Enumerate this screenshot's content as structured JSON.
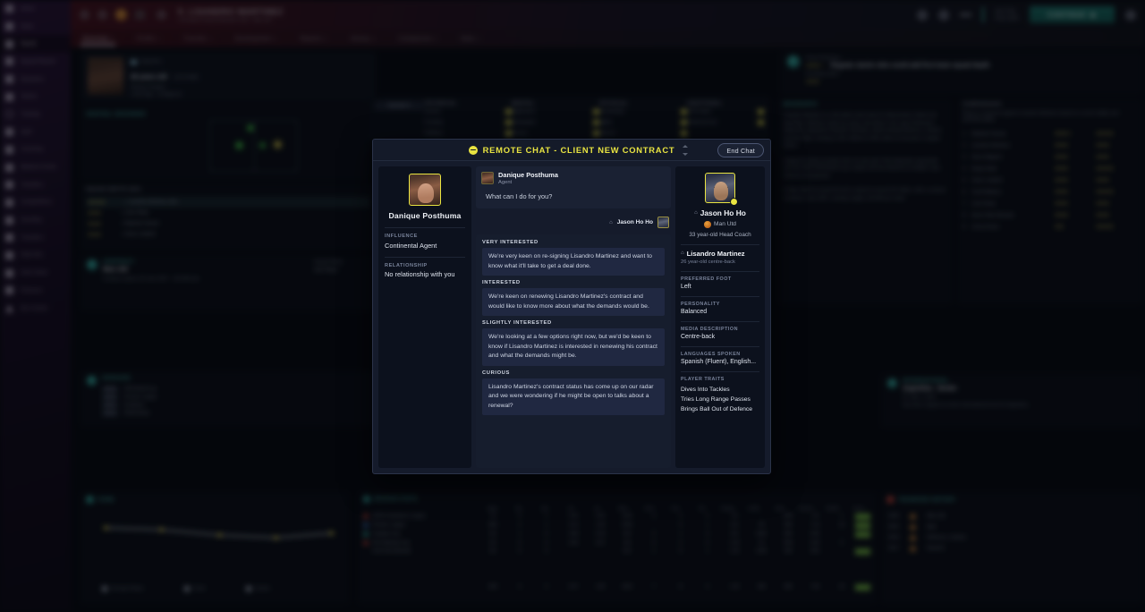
{
  "rail": {
    "items": [
      {
        "label": "Home",
        "icon": "home-icon"
      },
      {
        "label": "Inbox",
        "icon": "inbox-icon"
      },
      {
        "label": "Squad",
        "icon": "squad-icon"
      },
      {
        "label": "Squad Planner",
        "icon": "squad-planner-icon"
      },
      {
        "label": "Dynamics",
        "icon": "dynamics-icon"
      },
      {
        "label": "Tactics",
        "icon": "tactics-icon"
      },
      {
        "label": "Training",
        "icon": "training-icon"
      },
      {
        "label": "Staff",
        "icon": "staff-icon"
      },
      {
        "label": "Coaching",
        "icon": "coaching-icon"
      },
      {
        "label": "Medical Centre",
        "icon": "medical-icon"
      },
      {
        "label": "Transfers",
        "icon": "transfers-icon"
      },
      {
        "label": "Competitions",
        "icon": "competitions-icon"
      },
      {
        "label": "Scouting",
        "icon": "scouting-icon"
      },
      {
        "label": "Transfers",
        "icon": "transfer-list-icon"
      },
      {
        "label": "Club Info",
        "icon": "club-info-icon"
      },
      {
        "label": "Club Vision",
        "icon": "club-vision-icon"
      },
      {
        "label": "Finances",
        "icon": "finances-icon"
      },
      {
        "label": "Dev Centre",
        "icon": "dev-centre-icon"
      }
    ]
  },
  "topbar": {
    "title": "9. LISANDRO MARTINEZ",
    "subtitle": "Left-sided Central Defender (CD) - Man Utd",
    "date_line1": "Sat 3 Feb",
    "date_line2": "Prem 2025",
    "continue_label": "CONTINUE",
    "icons": [
      "back-icon",
      "search-icon",
      "ball-icon",
      "menu-icon",
      "magnify-icon",
      "social-icon",
      "help-icon",
      "inbox-count-icon"
    ]
  },
  "navtabs": [
    {
      "label": "Overview",
      "active": true,
      "caret": true
    },
    {
      "label": "Profile",
      "active": false,
      "caret": true
    },
    {
      "label": "Transfer",
      "active": false,
      "caret": true
    },
    {
      "label": "Development",
      "active": false,
      "caret": true
    },
    {
      "label": "Reports",
      "active": false,
      "caret": true
    },
    {
      "label": "History",
      "active": false,
      "caret": true
    },
    {
      "label": "Comparison",
      "active": false,
      "caret": true
    },
    {
      "label": "Stats",
      "active": false,
      "caret": true
    }
  ],
  "bg": {
    "player_card": {
      "flag_label": "Argentina",
      "age_line": "26 years old",
      "age_suffix": "(12/1/1998)",
      "line2": "Primary Position",
      "line3": "2 feet tags - Configured",
      "position_tag": "Central Defender"
    },
    "attributes": {
      "dropdown_label": "Highlight",
      "columns": [
        "TECHNICAL",
        "MENTAL",
        "PHYSICAL",
        "ADDITIONAL"
      ],
      "technical": [
        [
          "Corners",
          "5"
        ],
        [
          "Crossing",
          "6"
        ],
        [
          "Dribbling",
          "9"
        ]
      ],
      "mental": [
        [
          "Aggression",
          "15"
        ],
        [
          "Anticipation",
          "14"
        ],
        [
          "Bravery",
          "15"
        ]
      ],
      "physical": [
        [
          "Acceleration",
          "12"
        ],
        [
          "Agility",
          "13"
        ],
        [
          "Balance",
          "13"
        ]
      ],
      "additional": [
        [
          "Left Footed",
          ""
        ],
        [
          "Preferred Foot",
          "Left"
        ]
      ]
    },
    "scout_report": {
      "label": "Scout Summary",
      "headline": "Regular starter who could add first team squad depth",
      "sub": "Scouting report"
    },
    "biography": {
      "label": "BIOGRAPHY",
      "paragraphs": [
        "Lisandro Martinez is a left-sided centre-back for Manchester United and Argentina. Martinez made his senior club debut in the Liga Profesional Argentina, playing for Newell's Old Boys, before joining Defensa y Justicia and then Ajax, moving to Old Trafford in 2022 where he became a regular starter.",
        "Capped 41 times at senior level, he was part of the Argentina squad that won the 2022 FIFA World Cup in Qatar and has featured at multiple Copa America tournaments.",
        "In May 2024 he turned 26 and is valued at around 35 million, with a contract running to June 2027, earning roughly 120,000 per week."
      ]
    },
    "comparison": {
      "label": "COMPARISON",
      "sub": "Players compared against Lisandro Martinez based on current ability and potential ability",
      "rows": [
        {
          "n": "1",
          "name": "Raphael Varane",
          "left": "★★★☆",
          "right": "★★★★"
        },
        {
          "n": "2",
          "name": "Lisandro Martinez",
          "left": "★★★",
          "right": "★★★"
        },
        {
          "n": "3",
          "name": "Harry Maguire",
          "left": "★★★",
          "right": "★★★"
        },
        {
          "n": "4",
          "name": "Diogo Dalot",
          "left": "★★★",
          "right": "★★★★"
        },
        {
          "n": "5",
          "name": "Victor Lindelof",
          "left": "★★★",
          "right": "★★★"
        },
        {
          "n": "6",
          "name": "Tyrell Malacia",
          "left": "★★★",
          "right": "★★★★"
        },
        {
          "n": "7",
          "name": "Luke Shaw",
          "left": "★★★",
          "right": "★★★"
        },
        {
          "n": "8",
          "name": "Aaron Wan-Bissaka",
          "left": "★★★",
          "right": "★★★"
        },
        {
          "n": "9",
          "name": "Jonny Evans",
          "left": "★★",
          "right": "★★★★"
        }
      ]
    },
    "squad_depth": {
      "label": "SQUAD DEPTH (DC)",
      "rows": [
        {
          "stars": "★★★★",
          "name": "Lisandro Martinez (26)",
          "active": true
        },
        {
          "stars": "★★★",
          "name": "Luke Shaw",
          "active": false
        },
        {
          "stars": "★★★",
          "name": "Raphael Varane",
          "active": false
        },
        {
          "stars": "★★★",
          "name": "Victor Lindelof",
          "active": false
        }
      ]
    },
    "contract_panel": {
      "label": "CONTRACT",
      "club": "Man Utd",
      "detail": "Contract expires 30 June 2027 - 120,000 p/w",
      "right_l": "Squad Status",
      "right_v": "Star Player"
    },
    "honours_panel": {
      "label": "HONOURS",
      "rows": [
        {
          "tag": "2024",
          "text": "FIFA World Cup"
        },
        {
          "tag": "2022",
          "text": "Premier League"
        },
        {
          "tag": "2021",
          "text": "Eredivisie"
        },
        {
          "tag": "2019",
          "text": "KNVB Beker"
        }
      ]
    },
    "international": {
      "label": "INTERNATIONAL",
      "sub": "Argentina - Senior",
      "meta": "41 caps, 1 goal",
      "note": "Has been capped at senior international level for Argentina"
    },
    "form_chart": {
      "label": "FORM",
      "legend": [
        "Average Rating",
        "Goals",
        "Assists"
      ]
    },
    "season_table": {
      "label": "SEASON STATS",
      "columns": [
        "Apps",
        "Gls",
        "Ast",
        "xG",
        "xA",
        "Mins",
        "Shot",
        "Pas",
        "Tck",
        "Rating",
        "Int/90",
        "Hdrs",
        "Pass%",
        "Tck/90",
        "Cond"
      ],
      "rows": [
        {
          "crest": "red",
          "comp": "UEFA Champions League",
          "cells": [
            "14",
            "0",
            "1",
            "0.25",
            "0.52",
            "1132",
            "4",
            "2",
            "2",
            "18",
            "-",
            "29%",
            "7.8",
            "1"
          ],
          "pill": true
        },
        {
          "crest": "blue",
          "comp": "Premier League",
          "cells": [
            "28/2",
            "2",
            "1",
            "0.14",
            "1.42",
            "2154",
            "-",
            "5",
            "1",
            "112",
            "39",
            "300",
            "7.14",
            "10"
          ],
          "pill": true
        },
        {
          "crest": "green",
          "comp": "Carabao Cup",
          "cells": [
            "3/1",
            "1",
            "0",
            "0.08",
            "0.19",
            "412",
            "2",
            "1",
            "4",
            "101",
            "1002",
            "405",
            "6.95",
            "-"
          ],
          "pill": true
        },
        {
          "crest": "white",
          "comp": "FA Challenge Cup",
          "cells": [
            "2/1",
            "0",
            "0",
            "0.06",
            "0.07",
            "141",
            "0",
            "2",
            "0",
            "1.04",
            "10",
            "29%",
            "6.94",
            "4"
          ],
          "pill": false
        },
        {
          "crest": "none",
          "comp": "Club Internationals",
          "cells": [
            "4/1",
            "0",
            "0",
            "",
            "",
            "512",
            "1",
            "0",
            "1",
            "1.25",
            "1024",
            "205",
            "10%",
            ""
          ],
          "pill": true
        }
      ],
      "total": {
        "label": "Total",
        "cells": [
          "41/5",
          "3",
          "2",
          "0.47",
          "1.92",
          "3110",
          "7",
          "8",
          "4",
          "1.25",
          "184",
          "930",
          "7.04",
          "15"
        ]
      }
    },
    "form_footer": {
      "label": "TRANSFER HISTORY",
      "rows": [
        {
          "year": "2025",
          "text": "Man Utd"
        },
        {
          "year": "2022",
          "text": "Ajax"
        },
        {
          "year": "2019",
          "text": "Defensa y Justicia"
        },
        {
          "year": "2017",
          "text": "Newell's"
        }
      ]
    }
  },
  "modal": {
    "title": "REMOTE CHAT - CLIENT NEW CONTRACT",
    "title_icon": "chat-bubble-icon",
    "end_chat_label": "End Chat",
    "agent": {
      "name": "Danique Posthuma",
      "influence_label": "INFLUENCE",
      "influence_value": "Continental Agent",
      "relationship_label": "RELATIONSHIP",
      "relationship_value": "No relationship with you"
    },
    "message": {
      "sender": "Danique Posthuma",
      "sender_role": "Agent",
      "text": "What can I do for you?"
    },
    "you": {
      "name": "Jason Ho Ho"
    },
    "options": [
      {
        "category": "VERY INTERESTED",
        "text": "We're very keen on re-signing Lisandro Martinez and want to know what it'll take to get a deal done."
      },
      {
        "category": "INTERESTED",
        "text": "We're keen on renewing Lisandro Martinez's contract and would like to know more about what the demands would be."
      },
      {
        "category": "SLIGHTLY INTERESTED",
        "text": "We're looking at a few options right now, but we'd be keen to know if Lisandro Martinez is interested in renewing his contract and what the demands might be."
      },
      {
        "category": "CURIOUS",
        "text": "Lisandro Martinez's contract status has come up on our radar and we were wondering if he might be open to talks about a renewal?"
      }
    ],
    "player_panel": {
      "coach_name": "Jason Ho Ho",
      "coach_club": "Man Utd",
      "coach_meta": "33 year-old Head Coach",
      "player_name": "Lisandro Martinez",
      "player_sub": "26 year-old centre-back",
      "fields": [
        {
          "label": "PREFERRED FOOT",
          "value": "Left"
        },
        {
          "label": "PERSONALITY",
          "value": "Balanced"
        },
        {
          "label": "MEDIA DESCRIPTION",
          "value": "Centre-back"
        },
        {
          "label": "LANGUAGES SPOKEN",
          "value": "Spanish (Fluent), English..."
        }
      ],
      "traits_label": "PLAYER TRAITS",
      "traits": [
        "Dives Into Tackles",
        "Tries Long Range Passes",
        "Brings Ball Out of Defence"
      ]
    }
  },
  "colors": {
    "accent_yellow": "#e9e441",
    "accent_teal": "#2fa899",
    "modal_bg": "#151b2b",
    "option_bg": "#202841",
    "green_pill": "#6eb938"
  }
}
